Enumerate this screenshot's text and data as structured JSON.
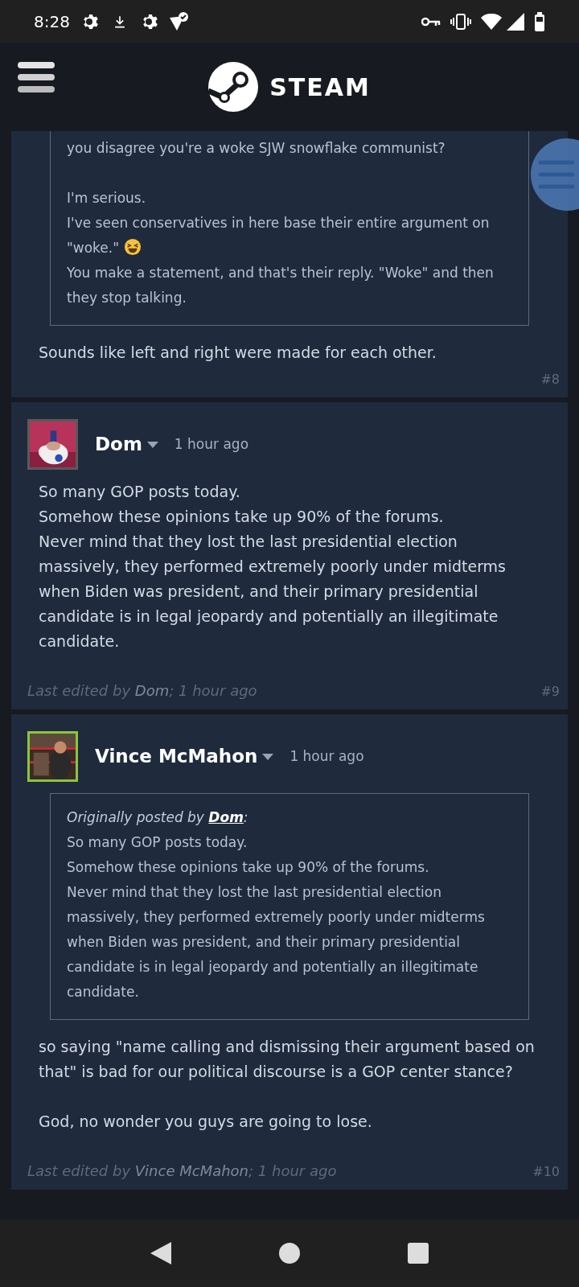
{
  "status_bar": {
    "time": "8:28"
  },
  "header": {
    "logo_text": "STEAM"
  },
  "posts": [
    {
      "quote": {
        "paragraphs": [
          {
            "lines": [
              {
                "text": "you disagree you're a woke SJW snowflake communist?",
                "emoji": false
              }
            ]
          },
          {
            "lines": [
              {
                "text": "I'm serious.",
                "emoji": false
              },
              {
                "text": "I've seen conservatives in here base their entire argument on \"woke.\"",
                "emoji": true
              },
              {
                "text": "You make a statement, and that's their reply. \"Woke\" and then they stop talking.",
                "emoji": false
              }
            ]
          }
        ]
      },
      "body": [
        {
          "lines": [
            "Sounds like left and right were made for each other."
          ]
        }
      ],
      "number": "#8"
    },
    {
      "author": "Dom",
      "in_game": false,
      "time": "1 hour ago",
      "body": [
        {
          "lines": [
            "So many GOP posts today.",
            "Somehow these opinions take up 90% of the forums.",
            "Never mind that they lost the last presidential election massively, they performed extremely poorly under midterms when Biden was president, and their primary presidential candidate is in legal jeopardy and potentially an illegitimate candidate."
          ]
        }
      ],
      "edit": {
        "prefix": "Last edited by ",
        "author": "Dom",
        "suffix": "; 1 hour ago"
      },
      "number": "#9"
    },
    {
      "author": "Vince McMahon",
      "in_game": true,
      "time": "1 hour ago",
      "quote": {
        "prefix": "Originally posted by ",
        "author": "Dom",
        "suffix": ":",
        "paragraphs": [
          {
            "lines": [
              {
                "text": "So many GOP posts today.",
                "emoji": false
              },
              {
                "text": "Somehow these opinions take up 90% of the forums.",
                "emoji": false
              },
              {
                "text": "Never mind that they lost the last presidential election massively, they performed extremely poorly under midterms when Biden was president, and their primary presidential candidate is in legal jeopardy and potentially an illegitimate candidate.",
                "emoji": false
              }
            ]
          }
        ]
      },
      "body": [
        {
          "lines": [
            "so saying \"name calling and dismissing their argument based on that\" is bad for our political discourse is a GOP center stance?"
          ]
        },
        {
          "lines": [
            "God, no wonder you guys are going to lose."
          ]
        }
      ],
      "edit": {
        "prefix": "Last edited by ",
        "author": "Vince McMahon",
        "suffix": "; 1 hour ago"
      },
      "number": "#10"
    }
  ]
}
